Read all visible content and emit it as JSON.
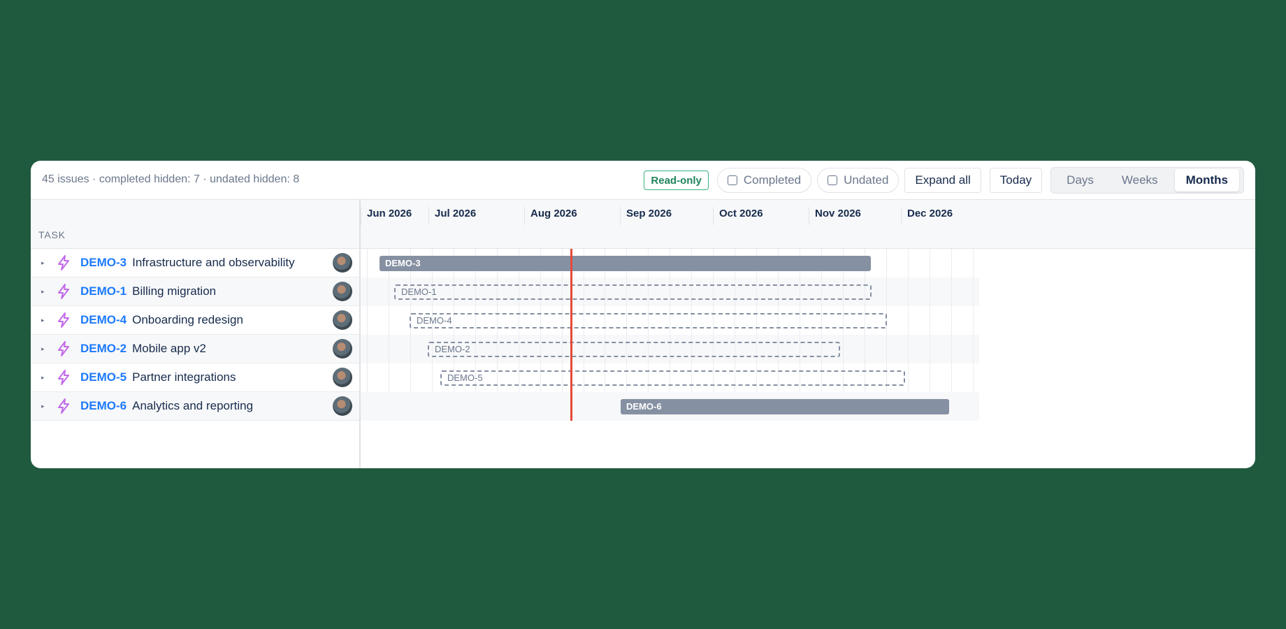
{
  "summary": "45 issues · completed hidden: 7 · undated hidden: 8",
  "toolbar": {
    "readonly_label": "Read-only",
    "completed_label": "Completed",
    "undated_label": "Undated",
    "expand_label": "Expand all",
    "today_label": "Today",
    "views": [
      "Days",
      "Weeks",
      "Months"
    ],
    "active_view": "Months"
  },
  "column_header": "TASK",
  "months": [
    "Jun 2026",
    "Jul 2026",
    "Aug 2026",
    "Sep 2026",
    "Oct 2026",
    "Nov 2026",
    "Dec 2026"
  ],
  "colors": {
    "accent": "#1d7afc",
    "bar": "#8590a2",
    "today_line": "#e5493a",
    "epic_icon": "#c26ae8"
  },
  "tasks": [
    {
      "key": "DEMO-3",
      "title": "Infrastructure and observability",
      "bar_label": "DEMO-3",
      "bar_style": "solid",
      "icon": "lightning-epic-icon"
    },
    {
      "key": "DEMO-1",
      "title": "Billing migration",
      "bar_label": "DEMO-1",
      "bar_style": "dashed",
      "icon": "lightning-epic-icon"
    },
    {
      "key": "DEMO-4",
      "title": "Onboarding redesign",
      "bar_label": "DEMO-4",
      "bar_style": "dashed",
      "icon": "lightning-epic-icon"
    },
    {
      "key": "DEMO-2",
      "title": "Mobile app v2",
      "bar_label": "DEMO-2",
      "bar_style": "dashed",
      "icon": "lightning-epic-icon"
    },
    {
      "key": "DEMO-5",
      "title": "Partner integrations",
      "bar_label": "DEMO-5",
      "bar_style": "dashed",
      "icon": "lightning-epic-icon"
    },
    {
      "key": "DEMO-6",
      "title": "Analytics and reporting",
      "bar_label": "DEMO-6",
      "bar_style": "solid",
      "icon": "lightning-epic-icon"
    }
  ]
}
